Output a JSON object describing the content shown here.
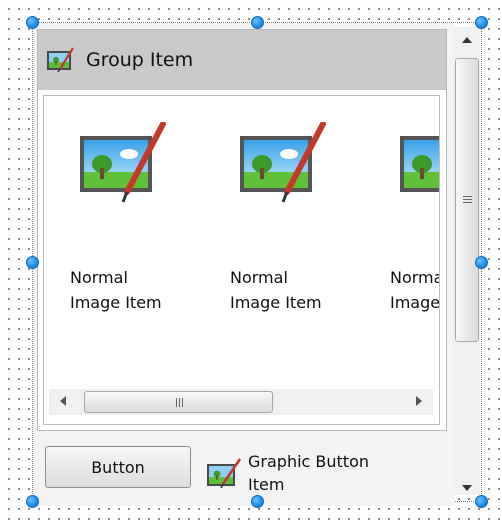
{
  "group": {
    "title": "Group Item",
    "icon": "image-edit-icon"
  },
  "gallery": {
    "items": [
      {
        "label": "Normal\nImage Item",
        "icon": "image-edit-icon"
      },
      {
        "label": "Normal\nImage Item",
        "icon": "image-edit-icon"
      },
      {
        "label": "Normal\nImage Item",
        "icon": "image-edit-icon"
      }
    ]
  },
  "footer": {
    "button_label": "Button",
    "graphic_button_label": "Graphic Button\nItem",
    "graphic_button_icon": "image-edit-icon"
  },
  "colors": {
    "selection_handle": "#1a8be6",
    "group_header": "#c9c9c9"
  }
}
